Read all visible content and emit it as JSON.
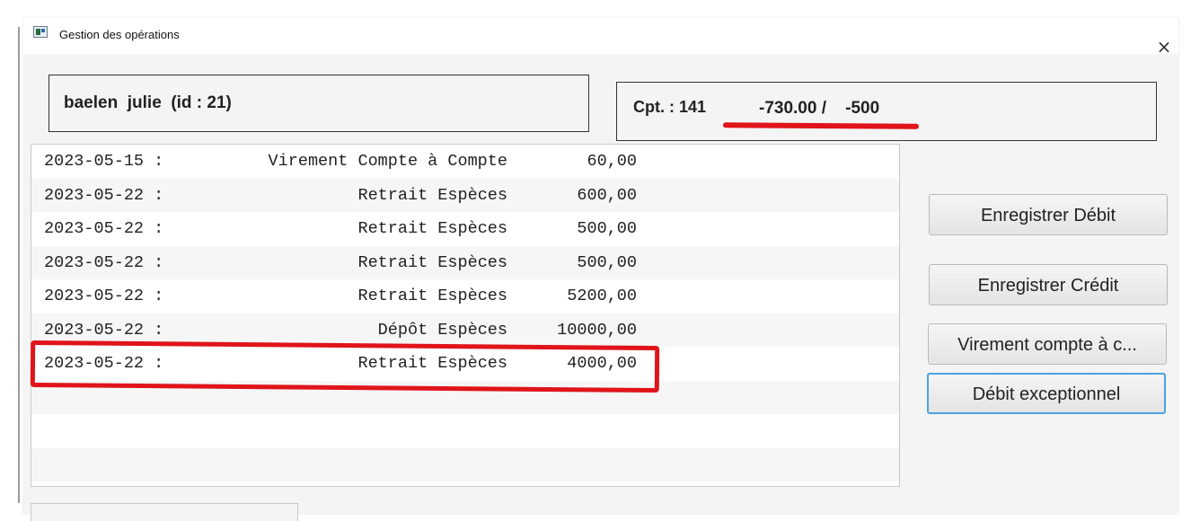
{
  "window": {
    "title": "Gestion des opérations",
    "close_glyph": "×"
  },
  "client": {
    "label": "baelen  julie  (id : 21)"
  },
  "account": {
    "number_label": "Cpt. : 141",
    "balance_text": "-730.00 /    -500"
  },
  "operations": [
    {
      "date": "2023-05-15 :",
      "label": "Virement Compte à Compte",
      "amount": "60,00"
    },
    {
      "date": "2023-05-22 :",
      "label": "Retrait Espèces",
      "amount": "600,00"
    },
    {
      "date": "2023-05-22 :",
      "label": "Retrait Espèces",
      "amount": "500,00"
    },
    {
      "date": "2023-05-22 :",
      "label": "Retrait Espèces",
      "amount": "500,00"
    },
    {
      "date": "2023-05-22 :",
      "label": "Retrait Espèces",
      "amount": "5200,00"
    },
    {
      "date": "2023-05-22 :",
      "label": "Dépôt Espèces",
      "amount": "10000,00"
    },
    {
      "date": "2023-05-22 :",
      "label": "Retrait Espèces",
      "amount": "4000,00"
    }
  ],
  "actions": {
    "debit_label": "Enregistrer Débit",
    "credit_label": "Enregistrer Crédit",
    "transfer_label": "Virement compte à c...",
    "exceptional_debit_label": "Débit exceptionnel"
  },
  "annotations": {
    "color": "#e0141a"
  },
  "icons": {
    "app": "app-window-icon",
    "close": "close-icon"
  }
}
